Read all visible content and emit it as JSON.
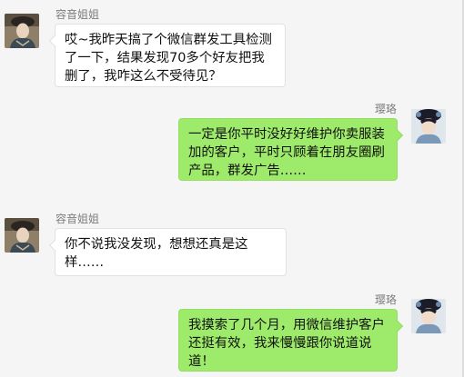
{
  "messages": [
    {
      "sender": "容音姐姐",
      "text": "哎~我昨天搞了个微信群发工具检测了一下，结果发现70多个好友把我删了，我咋这么不受待见？",
      "side": "left",
      "avatar_icon": "contact-avatar-icon"
    },
    {
      "sender": "璎珞",
      "text": "一定是你平时没好好维护你卖服装加的客户，平时只顾着在朋友圈刷产品，群发广告……",
      "side": "right",
      "avatar_icon": "contact-avatar-icon"
    },
    {
      "sender": "容音姐姐",
      "text": "你不说我没发现，想想还真是这样……",
      "side": "left",
      "avatar_icon": "contact-avatar-icon"
    },
    {
      "sender": "璎珞",
      "text": "我摸索了几个月，用微信维护客户还挺有效，我来慢慢跟你说道说道！",
      "side": "right",
      "avatar_icon": "contact-avatar-icon"
    }
  ],
  "colors": {
    "background": "#f5f5f5",
    "incoming_bubble": "#ffffff",
    "outgoing_bubble": "#9eea6a",
    "name_text": "#7d7d7d"
  }
}
